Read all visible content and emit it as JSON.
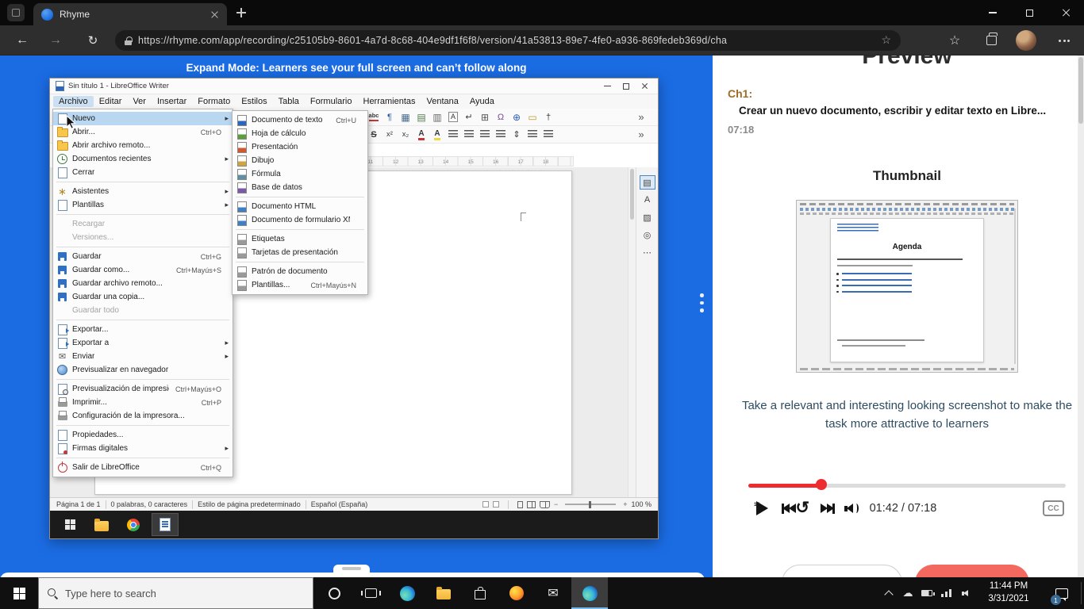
{
  "browser": {
    "tab_title": "Rhyme",
    "url": "https://rhyme.com/app/recording/c25105b9-8601-4a7d-8c68-404e9df1f6f8/version/41a53813-89e7-4fe0-a936-869fedeb369d/cha"
  },
  "banner": "Expand Mode: Learners see your full screen and can’t follow along",
  "writer": {
    "window_title": "Sin título 1 - LibreOffice Writer",
    "menubar": [
      "Archivo",
      "Editar",
      "Ver",
      "Insertar",
      "Formato",
      "Estilos",
      "Tabla",
      "Formulario",
      "Herramientas",
      "Ventana",
      "Ayuda"
    ],
    "active_menu": "Archivo",
    "file_menu": [
      {
        "label": "Nuevo",
        "submenu": true,
        "highlight": true,
        "icon": "new-doc"
      },
      {
        "label": "Abrir...",
        "shortcut": "Ctrl+O",
        "icon": "open-folder"
      },
      {
        "label": "Abrir archivo remoto...",
        "icon": "open-remote"
      },
      {
        "label": "Documentos recientes",
        "submenu": true,
        "icon": "recent"
      },
      {
        "label": "Cerrar",
        "icon": "close-doc"
      },
      {
        "sep": true
      },
      {
        "label": "Asistentes",
        "submenu": true,
        "icon": "wizard"
      },
      {
        "label": "Plantillas",
        "submenu": true,
        "icon": "templates"
      },
      {
        "sep": true
      },
      {
        "label": "Recargar",
        "disabled": true
      },
      {
        "label": "Versiones...",
        "disabled": true
      },
      {
        "sep": true
      },
      {
        "label": "Guardar",
        "shortcut": "Ctrl+G",
        "icon": "save"
      },
      {
        "label": "Guardar como...",
        "shortcut": "Ctrl+Mayús+S",
        "icon": "save-as"
      },
      {
        "label": "Guardar archivo remoto...",
        "icon": "save-remote"
      },
      {
        "label": "Guardar una copia...",
        "icon": "save-copy"
      },
      {
        "label": "Guardar todo",
        "disabled": true
      },
      {
        "sep": true
      },
      {
        "label": "Exportar...",
        "icon": "export"
      },
      {
        "label": "Exportar a",
        "submenu": true,
        "icon": "export-to"
      },
      {
        "label": "Enviar",
        "submenu": true,
        "icon": "send"
      },
      {
        "label": "Previsualizar en navegador",
        "icon": "preview-browser"
      },
      {
        "sep": true
      },
      {
        "label": "Previsualización de impresión",
        "shortcut": "Ctrl+Mayús+O",
        "icon": "print-preview"
      },
      {
        "label": "Imprimir...",
        "shortcut": "Ctrl+P",
        "icon": "print"
      },
      {
        "label": "Configuración de la impresora...",
        "icon": "printer-settings"
      },
      {
        "sep": true
      },
      {
        "label": "Propiedades...",
        "icon": "properties"
      },
      {
        "label": "Firmas digitales",
        "submenu": true,
        "icon": "signatures"
      },
      {
        "sep": true
      },
      {
        "label": "Salir de LibreOffice",
        "shortcut": "Ctrl+Q",
        "icon": "exit"
      }
    ],
    "new_submenu": [
      {
        "label": "Documento de texto",
        "shortcut": "Ctrl+U",
        "icon": "writer"
      },
      {
        "label": "Hoja de cálculo",
        "icon": "calc"
      },
      {
        "label": "Presentación",
        "icon": "impress"
      },
      {
        "label": "Dibujo",
        "icon": "draw"
      },
      {
        "label": "Fórmula",
        "icon": "math"
      },
      {
        "label": "Base de datos",
        "icon": "base"
      },
      {
        "sep": true
      },
      {
        "label": "Documento HTML",
        "icon": "html"
      },
      {
        "label": "Documento de formulario XML",
        "icon": "xml-form"
      },
      {
        "sep": true
      },
      {
        "label": "Etiquetas",
        "icon": "labels"
      },
      {
        "label": "Tarjetas de presentación",
        "icon": "cards"
      },
      {
        "sep": true
      },
      {
        "label": "Patrón de documento",
        "icon": "master"
      },
      {
        "label": "Plantillas...",
        "shortcut": "Ctrl+Mayús+N",
        "icon": "templates2"
      }
    ],
    "toolbar_standard": [
      "spellcheck",
      "formatting-marks",
      "insert-table",
      "insert-image",
      "insert-chart",
      "text-box",
      "page-break",
      "insert-field",
      "special-character",
      "hyperlink",
      "insert-comment",
      "footnote",
      "more"
    ],
    "toolbar_formatting": [
      "strikethrough",
      "superscript",
      "subscript",
      "font-color",
      "highlight-color",
      "align-left",
      "align-center",
      "align-right",
      "justify",
      "line-spacing",
      "bullet-list",
      "numbered-list",
      "more"
    ],
    "sidebar_tabs": [
      "properties",
      "styles",
      "gallery",
      "navigator",
      "more"
    ],
    "statusbar": {
      "page": "Página 1 de 1",
      "words": "0 palabras, 0 caracteres",
      "page_style": "Estilo de página predeterminado",
      "language": "Español (España)",
      "zoom": "100 %"
    },
    "inner_taskbar_icons": [
      "start",
      "file-explorer",
      "chrome",
      "writer-active"
    ]
  },
  "preview": {
    "heading": "Preview",
    "chapter_label": "Ch1:",
    "chapter_title": "Crear un nuevo documento, escribir y editar texto en Libre...",
    "chapter_duration": "07:18",
    "thumbnail_heading": "Thumbnail",
    "thumbnail_doc_title": "Agenda",
    "caption": "Take a relevant and interesting looking screenshot to make the task more attractive to learners",
    "player": {
      "progress_percent": 23,
      "time_display": "01:42 / 07:18",
      "cc_label": "CC",
      "controls": [
        "play",
        "skip-start",
        "replay-15",
        "skip-end",
        "volume"
      ]
    }
  },
  "taskbar": {
    "search_placeholder": "Type here to search",
    "icons": [
      "cortana",
      "task-view",
      "edge",
      "file-explorer",
      "store",
      "firefox",
      "mail",
      "edge-active"
    ],
    "tray_icons": [
      "tray-expand",
      "onedrive",
      "battery",
      "network",
      "volume"
    ],
    "clock_time": "11:44 PM",
    "clock_date": "3/31/2021",
    "notification_badge": "1"
  }
}
